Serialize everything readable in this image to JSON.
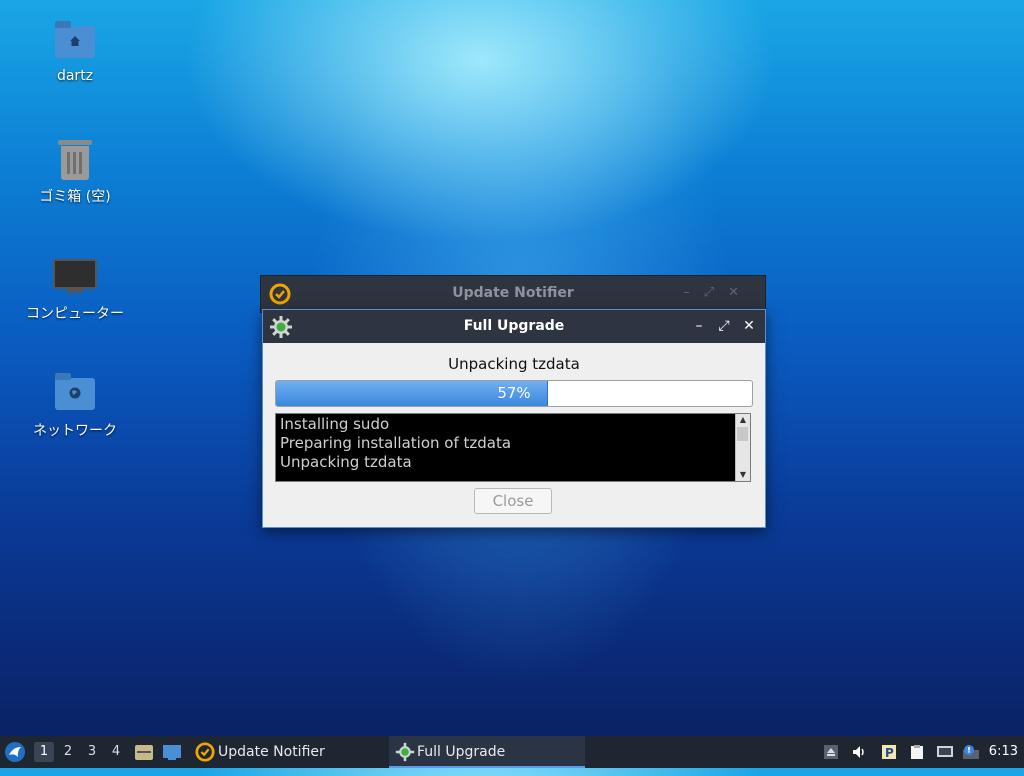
{
  "desktop": {
    "icons": [
      {
        "label": "dartz",
        "icon": "home-folder-icon"
      },
      {
        "label": "ゴミ箱 (空)",
        "icon": "trash-icon"
      },
      {
        "label": "コンピューター",
        "icon": "computer-icon"
      },
      {
        "label": "ネットワーク",
        "icon": "network-folder-icon"
      }
    ]
  },
  "background_window": {
    "title": "Update Notifier",
    "controls": [
      "–",
      "⤢",
      "✕"
    ]
  },
  "dialog": {
    "title": "Full Upgrade",
    "status": "Unpacking tzdata",
    "progress": {
      "value": 57,
      "label": "57%"
    },
    "log_lines": [
      "Installing sudo",
      "Preparing installation of tzdata",
      "Unpacking tzdata"
    ],
    "close_label": "Close",
    "controls": {
      "minimize": "–",
      "maximize": "⤢",
      "close": "✕"
    }
  },
  "taskbar": {
    "workspaces": [
      "1",
      "2",
      "3",
      "4"
    ],
    "active_workspace": "1",
    "tasks": [
      {
        "label": "Update Notifier",
        "active": false
      },
      {
        "label": "Full Upgrade",
        "active": true
      }
    ],
    "clock": "6:13",
    "tray_icons": [
      "eject-icon",
      "volume-icon",
      "parking-icon",
      "clipboard-icon",
      "network-icon",
      "update-alert-icon"
    ]
  },
  "colors": {
    "accent": "#3b86de",
    "titlebar": "#2f3540",
    "taskbar": "#1e2632"
  }
}
